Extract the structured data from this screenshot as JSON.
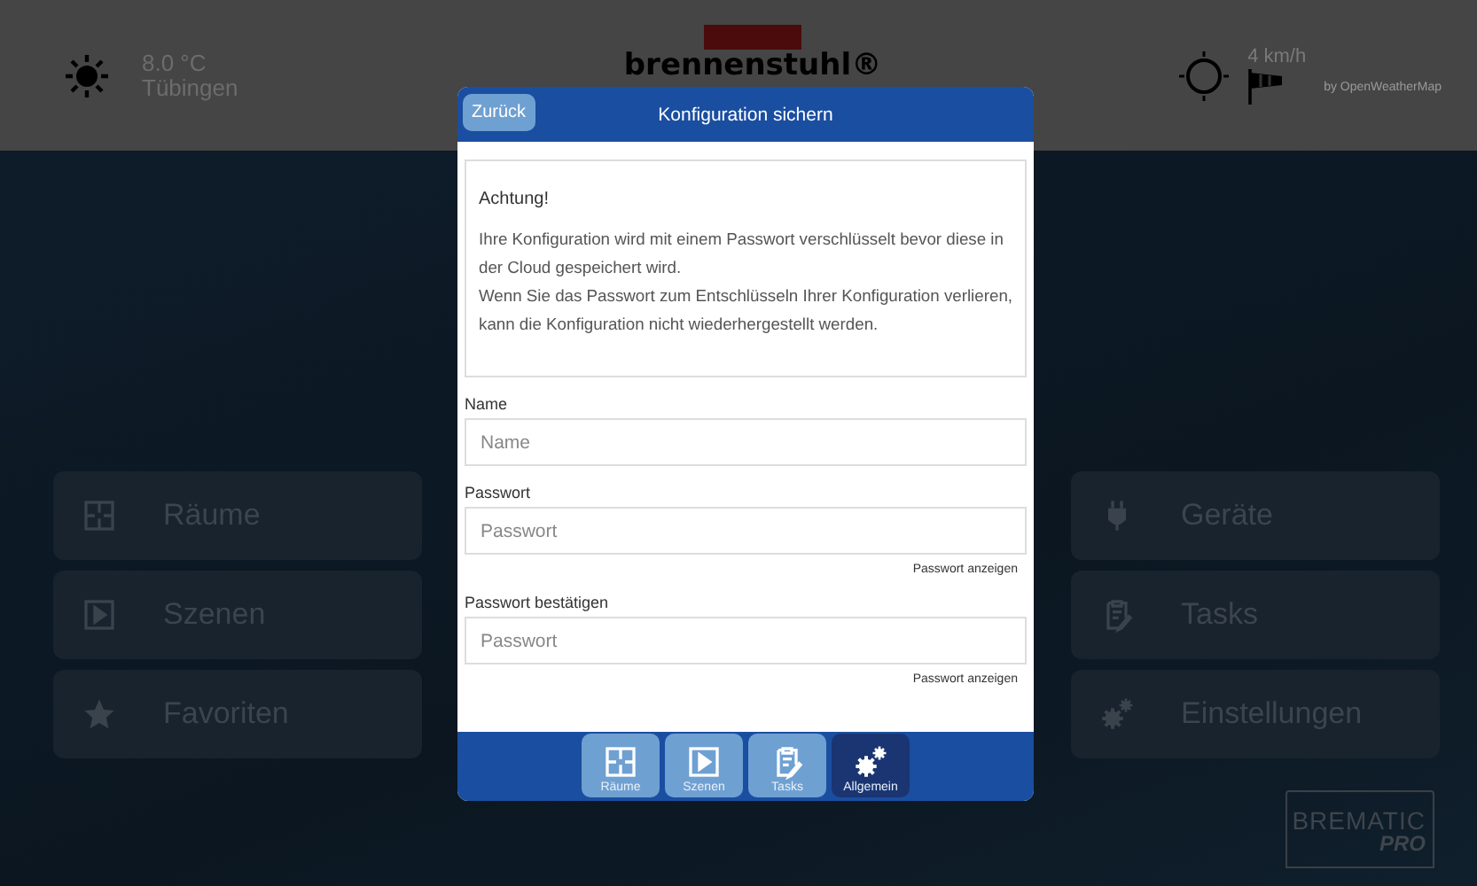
{
  "header": {
    "temperature": "8.0 °C",
    "city": "Tübingen",
    "logo": "brennenstuhl®",
    "wind_speed": "4 km/h",
    "credit": "by OpenWeatherMap"
  },
  "menu_left": [
    {
      "label": "Räume",
      "kind": "rooms"
    },
    {
      "label": "Szenen",
      "kind": "scenes"
    },
    {
      "label": "Favoriten",
      "kind": "favorites"
    }
  ],
  "menu_right": [
    {
      "label": "Geräte",
      "kind": "devices"
    },
    {
      "label": "Tasks",
      "kind": "tasks"
    },
    {
      "label": "Einstellungen",
      "kind": "settings"
    }
  ],
  "brand": {
    "name": "BREMATIC",
    "suffix": "PRO"
  },
  "dialog": {
    "back_button": "Zurück",
    "title": "Konfiguration sichern",
    "notice": {
      "heading": "Achtung!",
      "paragraphs": [
        "Ihre Konfiguration wird mit einem Passwort verschlüsselt bevor diese in der Cloud gespeichert wird.",
        "Wenn Sie das Passwort zum Entschlüsseln Ihrer Konfiguration verlieren, kann die Konfiguration nicht wiederhergestellt werden."
      ]
    },
    "fields": [
      {
        "label": "Name",
        "placeholder": "Name"
      },
      {
        "label": "Passwort",
        "placeholder": "Passwort",
        "toggle": "Passwort anzeigen"
      },
      {
        "label": "Passwort bestätigen",
        "placeholder": "Passwort",
        "toggle": "Passwort anzeigen"
      }
    ],
    "tabs": [
      {
        "label": "Räume",
        "kind": "rooms",
        "selected": false
      },
      {
        "label": "Szenen",
        "kind": "scenes",
        "selected": false
      },
      {
        "label": "Tasks",
        "kind": "tasks",
        "selected": false
      },
      {
        "label": "Allgemein",
        "kind": "settings",
        "selected": true
      }
    ]
  }
}
